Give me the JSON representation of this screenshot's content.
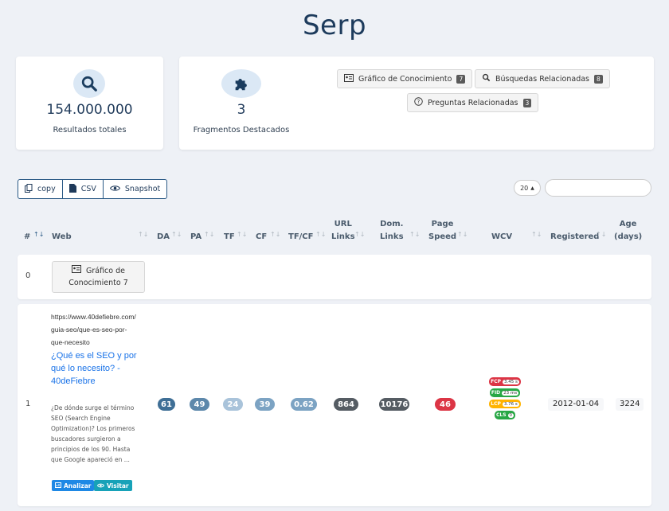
{
  "page": {
    "title": "Serp"
  },
  "stats": {
    "total": {
      "number": "154.000.000",
      "label": "Resultados totales",
      "icon": "search-icon"
    },
    "featured": {
      "number": "3",
      "label": "Fragmentos Destacados",
      "icon": "puzzle-icon"
    },
    "features": [
      {
        "label": "Gráfico de Conocimiento",
        "count": "7",
        "icon": "id-card-icon"
      },
      {
        "label": "Búsquedas Relacionadas",
        "count": "8",
        "icon": "search-icon"
      },
      {
        "label": "Preguntas Relacionadas",
        "count": "3",
        "icon": "question-icon"
      }
    ]
  },
  "toolbar": {
    "copy": "copy",
    "csv": "CSV",
    "snapshot": "Snapshot",
    "page_size": "20"
  },
  "table": {
    "headers": {
      "num": "#",
      "web": "Web",
      "da": "DA",
      "pa": "PA",
      "tf": "TF",
      "cf": "CF",
      "tfcf": "TF/CF",
      "url_links_1": "URL",
      "url_links_2": "Links",
      "dom_links_1": "Dom.",
      "dom_links_2": "Links",
      "speed_1": "Page",
      "speed_2": "Speed",
      "wcv": "WCV",
      "registered": "Registered",
      "age_1": "Age",
      "age_2": "(days)"
    },
    "row0": {
      "num": "0",
      "button_line1": "Gráfico de",
      "button_line2": "Conocimiento 7"
    },
    "row1": {
      "num": "1",
      "url1": "https://www.40defiebre.com/",
      "url2": "guia-seo/que-es-seo-por-",
      "url3": "que-necesito",
      "title1": "¿Qué es el SEO y por",
      "title2": "qué lo necesito? -",
      "title3": "40deFiebre",
      "desc": [
        "¿De dónde surge el término",
        "SEO (Search Engine",
        "Optimization)? Los primeros",
        "buscadores surgieron a",
        "principios de los 90. Hasta",
        "que Google apareció en ..."
      ],
      "analyze": "Analizar",
      "visit": "Visitar",
      "da": "61",
      "pa": "49",
      "tf": "24",
      "cf": "39",
      "tfcf": "0.62",
      "url_links": "864",
      "dom_links": "10176",
      "speed": "46",
      "wcv": {
        "fcp_label": "FCP",
        "fcp_val": "3.45 s",
        "fid_label": "FID",
        "fid_val": "23 ms",
        "lcp_label": "LCP",
        "lcp_val": "3.76 s",
        "cls_label": "CLS",
        "cls_val": "0"
      },
      "registered": "2012-01-04",
      "age": "3224"
    }
  },
  "colors": {
    "da": "#3f6f96",
    "pa": "#5d88ab",
    "tf": "#a9c3da",
    "cf": "#7ca3c3",
    "tfcf": "#7ca3c3",
    "url_links": "#555c63",
    "dom_links": "#555c63",
    "speed": "#dc3545",
    "fcp": "#dc3545",
    "fid": "#28a745",
    "lcp": "#ffb300",
    "cls": "#28a745",
    "analyze": "#1e88e5",
    "visit": "#17a2b8"
  }
}
